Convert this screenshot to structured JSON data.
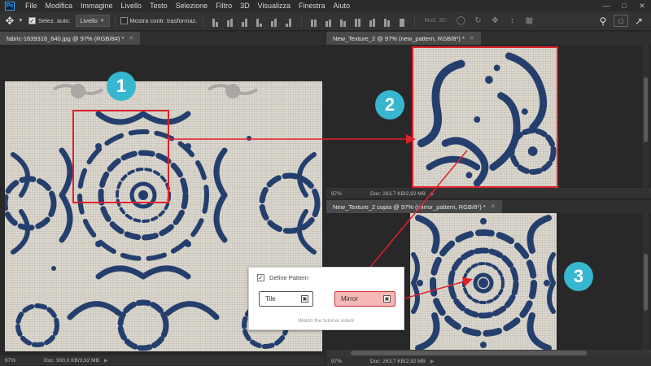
{
  "app": {
    "logo": "Ps",
    "menu": [
      "File",
      "Modifica",
      "Immagine",
      "Livello",
      "Testo",
      "Selezione",
      "Filtro",
      "3D",
      "Visualizza",
      "Finestra",
      "Aiuto"
    ],
    "window_controls": [
      "minimize-icon",
      "maximize-icon",
      "close-icon"
    ]
  },
  "options_bar": {
    "auto_select_label": "Selez. auto:",
    "auto_select_checked": true,
    "auto_select_value": "Livello",
    "show_transform_label": "Mostra contr. trasformaz.",
    "show_transform_checked": false,
    "mode_3d_label": "Mod. 3D:",
    "search_icon": "search-icon",
    "workspace_icon": "workspace-icon"
  },
  "documents": [
    {
      "tab": "fabric-1639318_640.jpg @ 97% (RGB/8#) *",
      "zoom": "97%",
      "doc_size": "Doc: 900,0 KB/3,92 MB"
    },
    {
      "tab": "New_Texture_2 @ 97% (new_pattern, RGB/8*) *",
      "zoom": "97%",
      "doc_size": "Doc: 263,7 KB/2,92 MB"
    },
    {
      "tab": "New_Texture_2 copia @ 97% (mirror_pattern, RGB/8*) *",
      "zoom": "97%",
      "doc_size": "Doc: 263,7 KB/2,92 MB"
    }
  ],
  "badges": [
    "1",
    "2",
    "3"
  ],
  "pattern_widget": {
    "title": "Define Pattern",
    "checked": true,
    "tile_label": "Tile",
    "mirror_label": "Mirror",
    "link_text": "Watch the tutorial video!"
  },
  "colors": {
    "accent_red": "#e0202a",
    "badge": "#37b7cf",
    "pattern_blue": "#243f6e",
    "fabric": "#dcd8ce"
  }
}
